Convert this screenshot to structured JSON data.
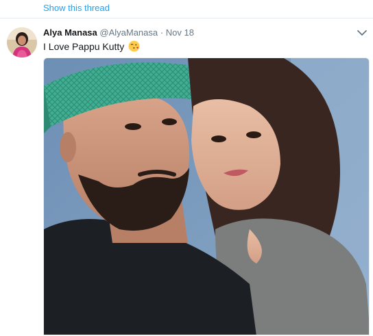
{
  "thread": {
    "show_thread_label": "Show this thread"
  },
  "tweet": {
    "author_name": "Alya Manasa",
    "author_handle": "@AlyaManasa",
    "separator": "·",
    "date": "Nov 18",
    "text": "I Love Pappu Kutty",
    "emoji_icon": "face-blowing-kiss-icon"
  },
  "colors": {
    "link": "#1da1f2",
    "name": "#14171a",
    "meta": "#657786",
    "divider": "#e6ecf0"
  }
}
